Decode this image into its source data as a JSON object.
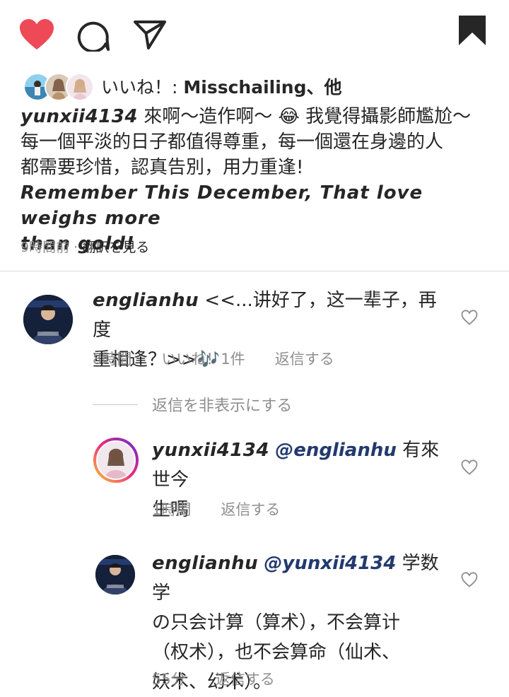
{
  "actions": {
    "like_icon": "heart-filled-icon",
    "comment_icon": "comment-icon",
    "share_icon": "paper-plane-icon",
    "save_icon": "bookmark-filled-icon",
    "like_color": "#ed4956"
  },
  "likes": {
    "prefix": "いいね！: ",
    "name": "Misschailing",
    "suffix": "、他"
  },
  "caption": {
    "username": "yunxii4134",
    "line1": " 來啊～造作啊～ 😂 我覺得攝影師尷尬～",
    "line2": "每一個平淡的日子都值得尊重，每一個還在身邊的人",
    "line3": "都需要珍惜，認真告別，用力重逢!",
    "line4": "Remember This December, That love weighs more",
    "line5": "than gold!"
  },
  "meta": {
    "time": "9時間前",
    "separator": " · ",
    "translate": "翻訳を見る"
  },
  "comments": [
    {
      "username": "englianhu",
      "text_line1": " <<...讲好了，这一辈子，再度",
      "text_line2": "重相逢？>>🎶",
      "time": "8時間",
      "likes": "いいね！1件",
      "reply": "返信する"
    }
  ],
  "hide_replies": "返信を非表示にする",
  "replies": [
    {
      "username": "yunxii4134",
      "mention": "@englianhu",
      "text_line1": " 有來世今",
      "text_line2": "生嗎",
      "time": "1時間",
      "reply": "返信する"
    },
    {
      "username": "englianhu",
      "mention": "@yunxii4134",
      "text_line1": " 学数学",
      "text_line2": "の只会计算（算术），不会算计",
      "text_line3": "（权术），也不会算命（仙术、",
      "text_line4": "妖术、幻术）。",
      "time": "55分",
      "reply": "返信する"
    }
  ]
}
